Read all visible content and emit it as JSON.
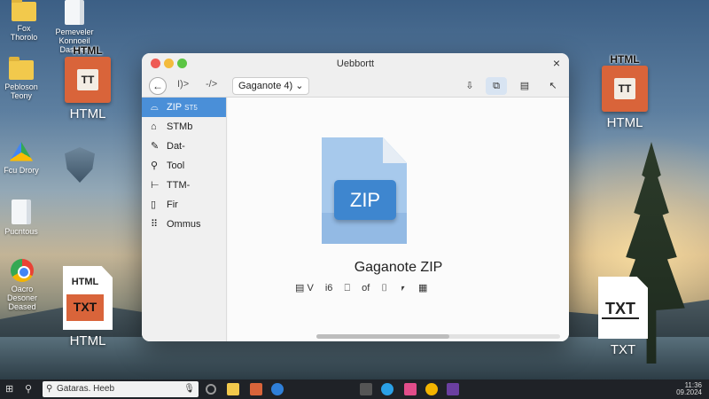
{
  "desktop": {
    "icons_left": [
      {
        "label": "Fox Thorolo",
        "icon": "folder-icon"
      },
      {
        "label": "Pemeveler\nKonnoeil Dasteds",
        "icon": "paper-icon"
      },
      {
        "label": "Pebloson\nTeony",
        "icon": "folder-icon"
      },
      {
        "label": "Fcu Drory",
        "icon": "drive-icon"
      },
      {
        "label": "Pucntous",
        "icon": "document-icon"
      },
      {
        "label": "Oacro Desoner\nDeased",
        "icon": "chrome-icon"
      }
    ],
    "html_tile_top": {
      "top": "HTML",
      "inner": "TT",
      "label": "HTML"
    },
    "html_tile_bottom": {
      "top": "HTML",
      "inner": "TXT",
      "label": "HTML"
    },
    "html_tile_right": {
      "top": "HTML",
      "inner": "TT",
      "label": "HTML"
    },
    "txt_tile_right": {
      "inner": "TXT",
      "label": "TXT"
    }
  },
  "window": {
    "title": "Uebbortt",
    "close_glyph": "×",
    "toolbar": {
      "back_glyph": "←",
      "forward_label": "I)>",
      "next_label": "-/>",
      "path_label": "Gaganote 4) ",
      "path_chevron": "⌄",
      "btn_download": "⇩",
      "btn_split": "⧉",
      "btn_view": "▤",
      "btn_collapse": "↖"
    },
    "sidebar": [
      {
        "icon": "folder-icon",
        "glyph": "⌓",
        "label": "ZIP",
        "sub": "ST5",
        "selected": true
      },
      {
        "icon": "home-icon",
        "glyph": "⌂",
        "label": "STMb",
        "sub": "",
        "selected": false
      },
      {
        "icon": "pen-icon",
        "glyph": "✎",
        "label": "Dat-",
        "sub": "",
        "selected": false
      },
      {
        "icon": "wrench-icon",
        "glyph": "⚲",
        "label": "Tool",
        "sub": "",
        "selected": false
      },
      {
        "icon": "tag-icon",
        "glyph": "⊢",
        "label": "TTM-",
        "sub": "",
        "selected": false
      },
      {
        "icon": "file-icon",
        "glyph": "▯",
        "label": "Fir",
        "sub": "",
        "selected": false
      },
      {
        "icon": "grid-icon",
        "glyph": "⠿",
        "label": "Ommus",
        "sub": "",
        "selected": false
      }
    ],
    "file": {
      "badge": "ZIP",
      "name": "Gaganote ZIP",
      "actions": [
        "▤ V",
        "i6",
        "⎕",
        "of",
        "⌷",
        "⎖",
        "▦"
      ]
    }
  },
  "taskbar": {
    "start_glyph": "⊞",
    "search_glyph": "⚲",
    "search_placeholder": "Gataras. Heeb",
    "mic_glyph": "🎙",
    "clock_line1": "11:36",
    "clock_line2": "09.2024"
  }
}
